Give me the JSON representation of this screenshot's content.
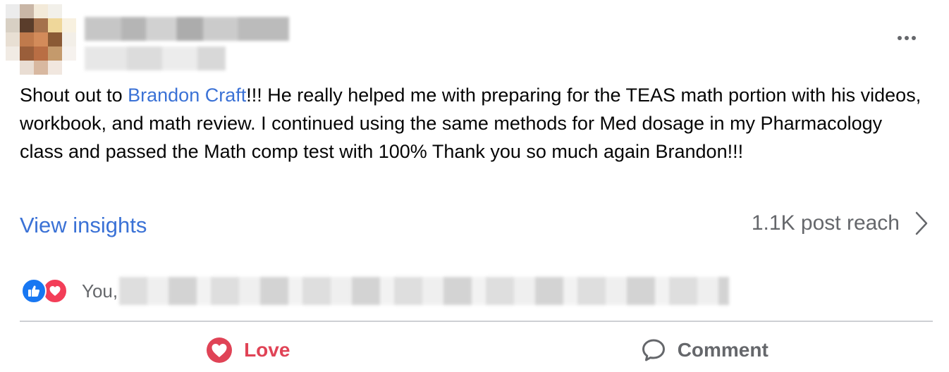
{
  "post": {
    "text_before": "Shout out to ",
    "mention": "Brandon Craft",
    "text_after": "!!! He really helped me with preparing for the TEAS math portion with his videos, workbook, and math review. I continued using the same methods for Med dosage in my Pharmacology class and passed the Math comp test with 100% Thank you so much again Brandon!!!"
  },
  "insights": {
    "link_label": "View insights",
    "reach_label": "1.1K post reach"
  },
  "reactions": {
    "icons": [
      "like-icon",
      "heart-icon"
    ],
    "names_prefix": "You,"
  },
  "actions": {
    "love_label": "Love",
    "comment_label": "Comment"
  },
  "colors": {
    "link": "#3b72d6",
    "love": "#e04356",
    "like": "#1877f2",
    "heart": "#f33e58",
    "muted": "#65676b"
  }
}
